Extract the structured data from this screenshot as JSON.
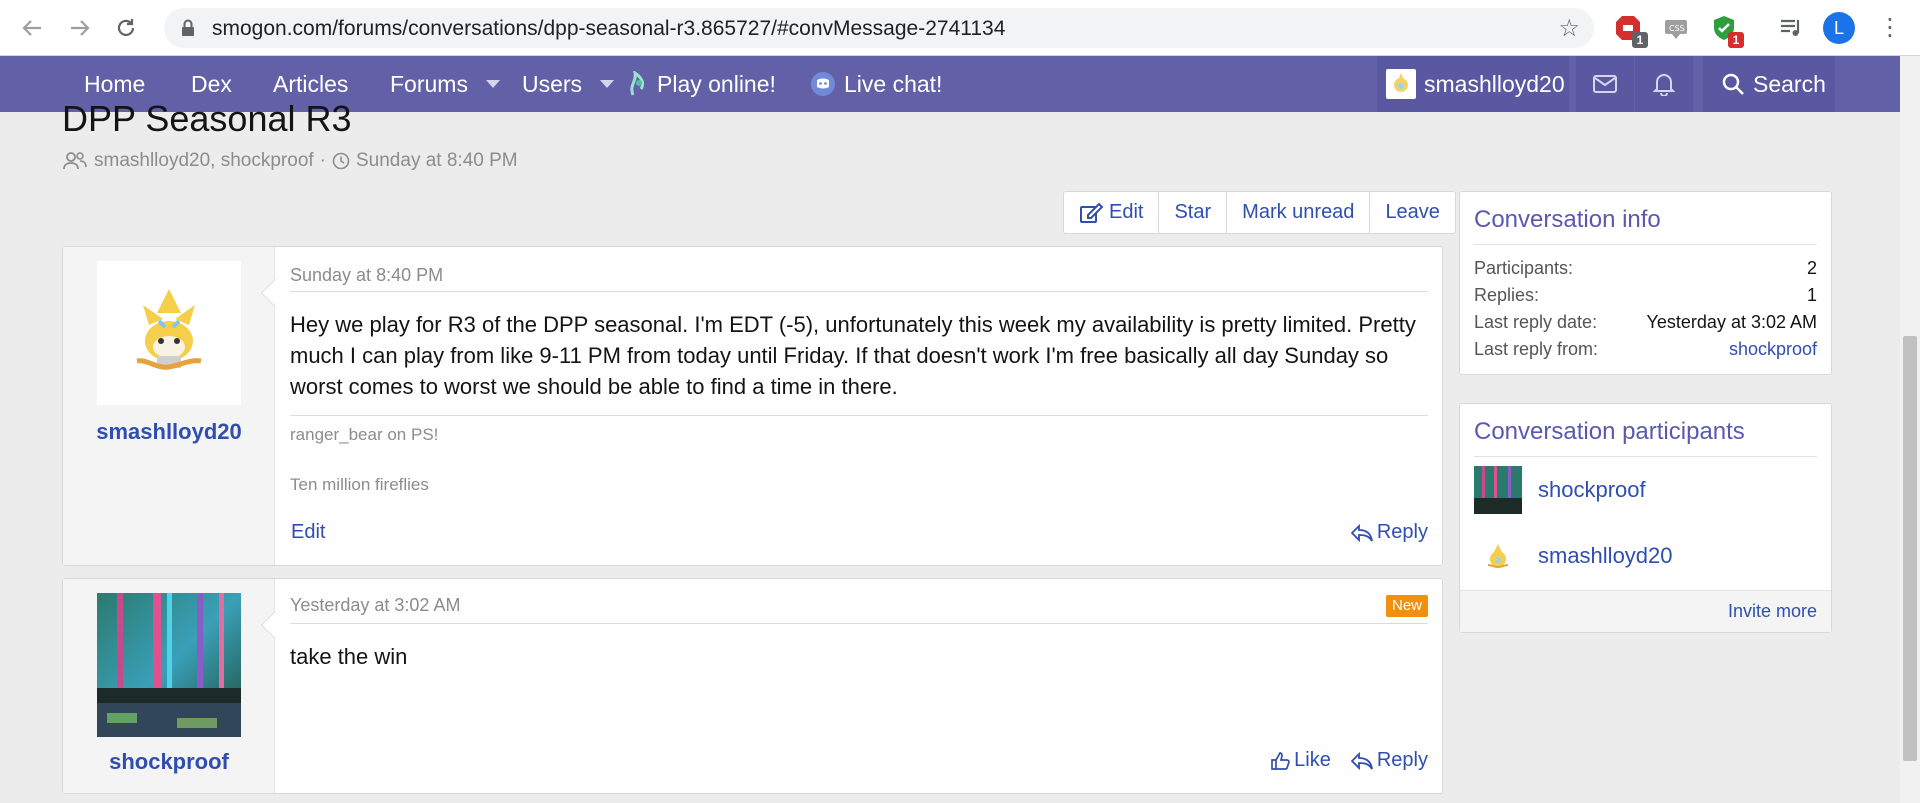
{
  "browser": {
    "url": "smogon.com/forums/conversations/dpp-seasonal-r3.865727/#convMessage-2741134",
    "ext_badge_1": "1",
    "ext_badge_2": "1",
    "profile_initial": "L"
  },
  "nav": {
    "home": "Home",
    "dex": "Dex",
    "articles": "Articles",
    "forums": "Forums",
    "users": "Users",
    "play_online": "Play online!",
    "live_chat": "Live chat!",
    "username": "smashlloyd20",
    "search": "Search"
  },
  "conversation": {
    "title": "DPP Seasonal R3",
    "participants_text": "smashlloyd20, shockproof",
    "separator": "·",
    "started": "Sunday at 8:40 PM"
  },
  "actions": {
    "edit": "Edit",
    "star": "Star",
    "mark_unread": "Mark unread",
    "leave": "Leave"
  },
  "messages": [
    {
      "author": "smashlloyd20",
      "date": "Sunday at 8:40 PM",
      "body": "Hey we play for R3 of the DPP seasonal. I'm EDT (-5), unfortunately this week my availability is pretty limited. Pretty much I can play from like 9-11 PM from today until Friday. If that doesn't work I'm free basically all day Sunday so worst comes to worst we should be able to find a time in there.",
      "signature_line1": "ranger_bear on PS!",
      "signature_line2": "Ten million fireflies",
      "edit_label": "Edit",
      "reply_label": "Reply"
    },
    {
      "author": "shockproof",
      "date": "Yesterday at 3:02 AM",
      "badge": "New",
      "body": "take the win",
      "like_label": "Like",
      "reply_label": "Reply"
    }
  ],
  "sidebar": {
    "info_title": "Conversation info",
    "info_rows": [
      {
        "label": "Participants:",
        "value": "2"
      },
      {
        "label": "Replies:",
        "value": "1"
      },
      {
        "label": "Last reply date:",
        "value": "Yesterday at 3:02 AM"
      },
      {
        "label": "Last reply from:",
        "value": "shockproof"
      }
    ],
    "participants_title": "Conversation participants",
    "participants": [
      "shockproof",
      "smashlloyd20"
    ],
    "invite_more": "Invite more"
  },
  "colors": {
    "nav_bg": "#6260a7",
    "link": "#2f4eb0",
    "heading_accent": "#5a58b0",
    "new_badge": "#f0900e"
  }
}
